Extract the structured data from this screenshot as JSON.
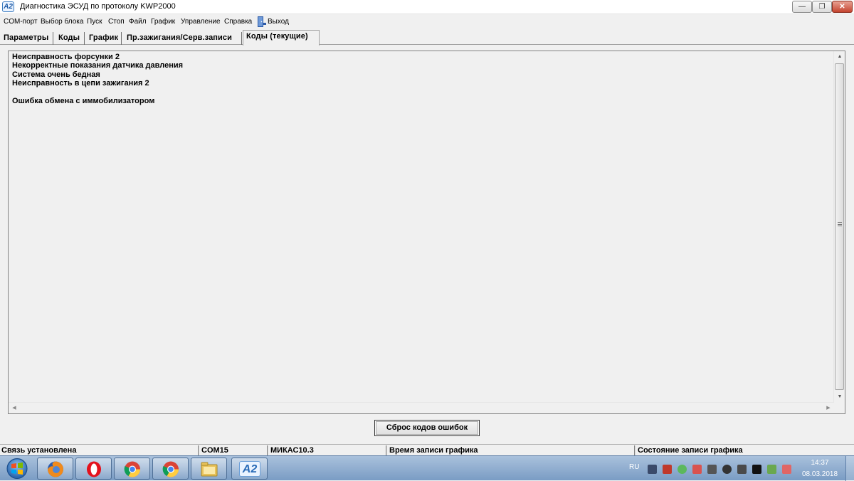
{
  "window": {
    "title": "Диагностика ЭСУД по протоколу KWP2000",
    "icon_label": "A2",
    "minimize_glyph": "—",
    "maximize_glyph": "❐",
    "close_glyph": "✕"
  },
  "menu": {
    "items": [
      "COM-порт",
      "Выбор блока",
      "Пуск",
      "Стоп",
      "Файл",
      "График",
      "Управление",
      "Справка",
      "Выход"
    ]
  },
  "tabs": {
    "items": [
      "Параметры",
      "Коды",
      "График",
      "Пр.зажигания/Серв.записи",
      "Коды (текущие)"
    ],
    "active_index": 4
  },
  "codes": {
    "lines": [
      "Неисправность форсунки 2",
      "Некорректные показания датчика давления",
      "Система очень бедная",
      "Неисправность в цепи зажигания 2",
      "",
      "Ошибка обмена с иммобилизатором"
    ]
  },
  "reset_button": {
    "label": "Сброс кодов ошибок"
  },
  "statusbar": {
    "connection": "Связь установлена",
    "port": "COM15",
    "ecu": "МИКАС10.3",
    "graph_time": "Время записи графика",
    "graph_state": "Состояние записи графика"
  },
  "taskbar": {
    "apps": [
      "firefox-icon",
      "opera-icon",
      "chrome-icon",
      "chrome-icon",
      "file-manager-icon",
      "a2-app-icon"
    ],
    "a2_label": "A2",
    "language": "RU",
    "time": "14:37",
    "date": "08.03.2018"
  },
  "colors": {
    "window_bg": "#f0f0f0",
    "taskbar": "#8fb0d6",
    "close_button": "#c5442f"
  }
}
